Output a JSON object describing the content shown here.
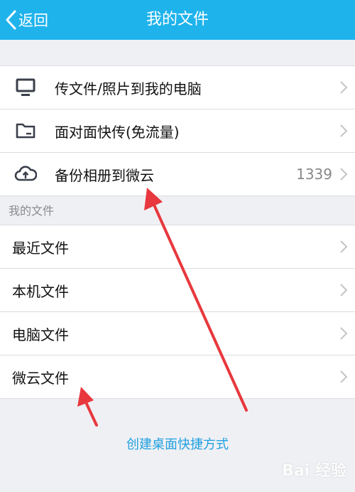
{
  "header": {
    "back_label": "返回",
    "title": "我的文件"
  },
  "quick_actions": [
    {
      "label": "传文件/照片到我的电脑",
      "icon": "monitor-icon"
    },
    {
      "label": "面对面快传(免流量)",
      "icon": "folder-icon"
    },
    {
      "label": "备份相册到微云",
      "icon": "cloud-upload-icon",
      "count": "1339"
    }
  ],
  "my_files": {
    "section_label": "我的文件",
    "items": [
      {
        "label": "最近文件"
      },
      {
        "label": "本机文件"
      },
      {
        "label": "电脑文件"
      },
      {
        "label": "微云文件"
      }
    ]
  },
  "footer": {
    "shortcut_link": "创建桌面快捷方式"
  },
  "watermark": "Bai 经验",
  "colors": {
    "nav_bar": "#1fb3ec",
    "link": "#1fa0e0",
    "annotation_arrow": "#e8383d",
    "background": "#eff0f4"
  }
}
